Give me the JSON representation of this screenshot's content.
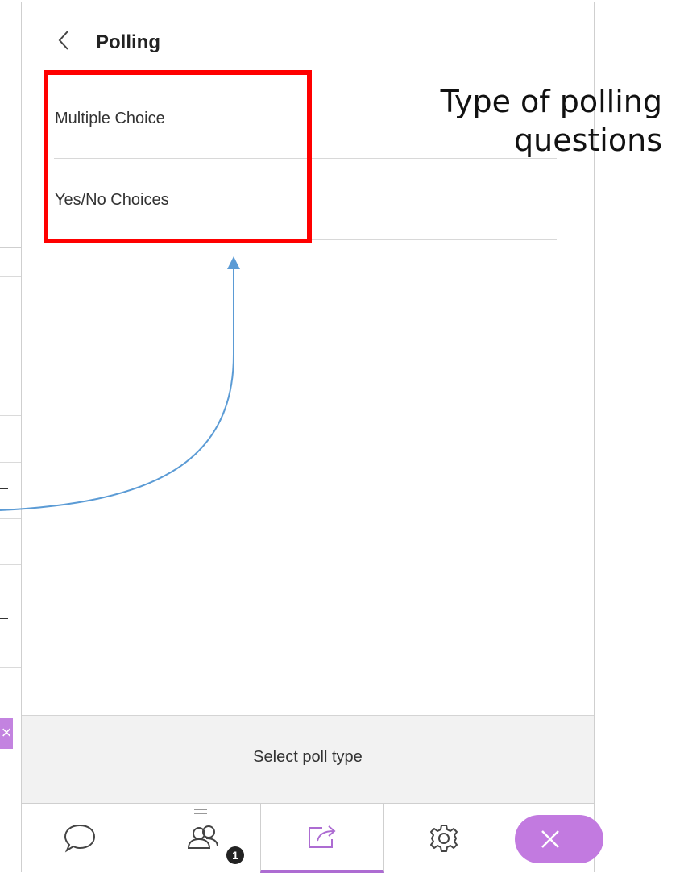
{
  "header": {
    "title": "Polling"
  },
  "options": [
    {
      "label": "Multiple Choice"
    },
    {
      "label": "Yes/No Choices"
    }
  ],
  "footer": {
    "status": "Select poll type"
  },
  "toolbar": {
    "items": [
      {
        "name": "chat",
        "icon": "chat-bubble-icon"
      },
      {
        "name": "attendees",
        "icon": "people-icon",
        "badge": "1"
      },
      {
        "name": "share-content",
        "icon": "share-icon",
        "active": true
      },
      {
        "name": "settings",
        "icon": "gear-icon"
      },
      {
        "name": "close",
        "icon": "close-icon"
      }
    ]
  },
  "annotation": {
    "line1": "Type of polling",
    "line2": "questions"
  },
  "colors": {
    "highlight": "#ff0000",
    "accent": "#c27ae0",
    "arrow": "#5b9bd5"
  }
}
